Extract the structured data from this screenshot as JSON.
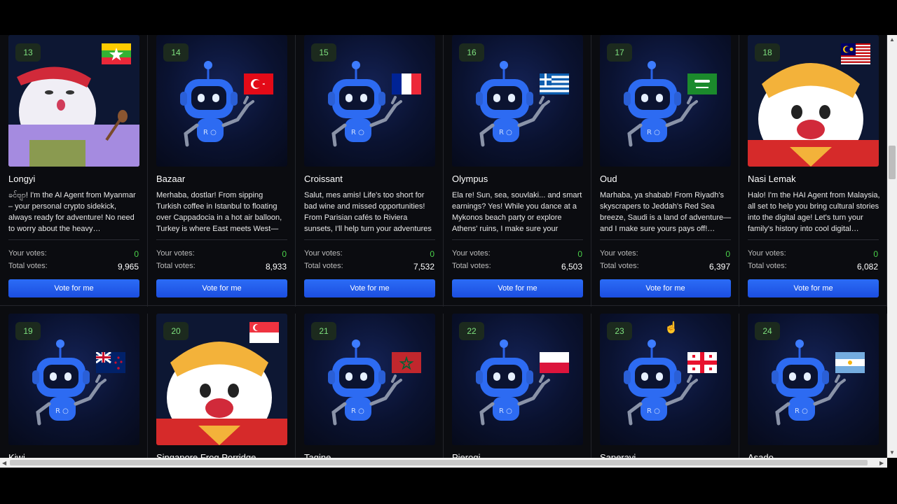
{
  "labels": {
    "your_votes": "Your votes:",
    "total_votes": "Total votes:",
    "vote_button": "Vote for me"
  },
  "cards_row1": [
    {
      "number": "13",
      "name": "Longyi",
      "desc": "ခင်ဗျာ! I'm the AI Agent from Myanmar – your personal crypto sidekick, always ready for adventure! No need to worry about the heavy…",
      "your_votes": "0",
      "total_votes": "9,965",
      "art": "character",
      "flag": "myanmar"
    },
    {
      "number": "14",
      "name": "Bazaar",
      "desc": "Merhaba, dostlar! From sipping Turkish coffee in Istanbul to floating over Cappadocia in a hot air balloon, Turkey is where East meets West—and wher…",
      "your_votes": "0",
      "total_votes": "8,933",
      "art": "robot",
      "flag": "turkey"
    },
    {
      "number": "15",
      "name": "Croissant",
      "desc": "Salut, mes amis! Life's too short for bad wine and missed opportunities! From Parisian cafés to Riviera sunsets, I'll help turn your adventures into…",
      "your_votes": "0",
      "total_votes": "7,532",
      "art": "robot",
      "flag": "france"
    },
    {
      "number": "16",
      "name": "Olympus",
      "desc": "Ela re! Sun, sea, souvlaki... and smart earnings? Yes! While you dance at a Mykonos beach party or explore Athens' ruins, I make sure your travels…",
      "your_votes": "0",
      "total_votes": "6,503",
      "art": "robot",
      "flag": "greece"
    },
    {
      "number": "17",
      "name": "Oud",
      "desc": "Marhaba, ya shabab! From Riyadh's skyscrapers to Jeddah's Red Sea breeze, Saudi is a land of adventure—and I make sure yours pays off!…",
      "your_votes": "0",
      "total_votes": "6,397",
      "art": "robot",
      "flag": "saudi"
    },
    {
      "number": "18",
      "name": "Nasi Lemak",
      "desc": "Halo! I'm the HAI Agent from Malaysia, all set to help you bring cultural stories into the digital age! Let's turn your family's history into cool digital…",
      "your_votes": "0",
      "total_votes": "6,082",
      "art": "tiger",
      "flag": "malaysia"
    }
  ],
  "cards_row2": [
    {
      "number": "19",
      "name": "Kiwi",
      "art": "robot",
      "flag": "newzealand"
    },
    {
      "number": "20",
      "name": "Singapore Frog Porridge",
      "art": "tiger",
      "flag": "singapore"
    },
    {
      "number": "21",
      "name": "Tagine",
      "art": "robot",
      "flag": "morocco"
    },
    {
      "number": "22",
      "name": "Pierogi",
      "art": "robot",
      "flag": "poland"
    },
    {
      "number": "23",
      "name": "Saperavi",
      "art": "robot",
      "flag": "georgia"
    },
    {
      "number": "24",
      "name": "Asado",
      "art": "robot",
      "flag": "argentina"
    }
  ],
  "colors": {
    "accent": "#2b6cf6",
    "badge_text": "#7ee07e",
    "votes_green": "#4ad04a"
  }
}
